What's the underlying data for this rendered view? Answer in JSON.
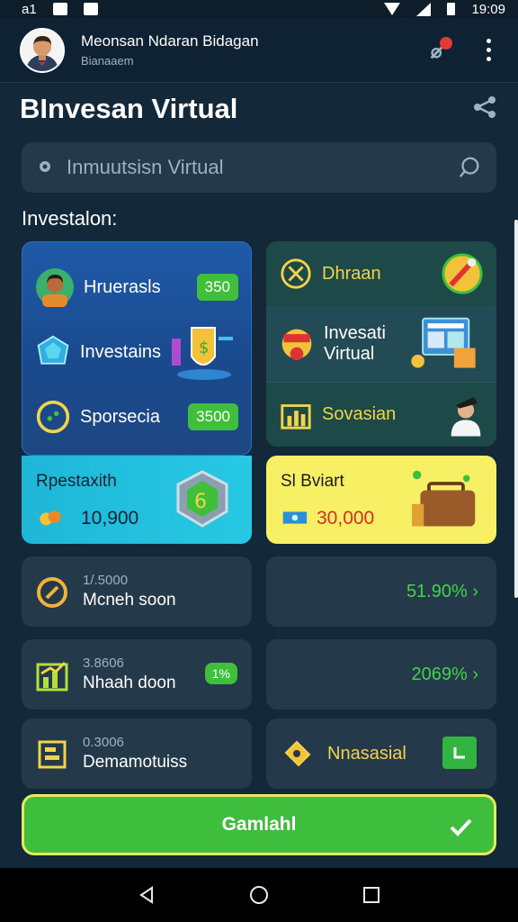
{
  "status_bar": {
    "left_text": "a1",
    "time": "19:09"
  },
  "header": {
    "name": "Meonsan Ndaran Bidagan",
    "subtitle": "Bianaaem"
  },
  "page_title": "Invesan Virtual",
  "title_prefix": "B",
  "search": {
    "placeholder": "Inmuutsisn Virtual"
  },
  "section_label": "Investalon:",
  "blue_card": {
    "rows": [
      {
        "label": "Hruerasls",
        "value": "350"
      },
      {
        "label": "Investains",
        "value": ""
      },
      {
        "label": "Sporsecia",
        "value": "3500"
      }
    ]
  },
  "dark_card": {
    "rows": [
      {
        "label": "Dhraan"
      },
      {
        "label": "Invesati Virtual"
      },
      {
        "label": "Sovasian"
      }
    ]
  },
  "cyan_card": {
    "title": "Rpestaxith",
    "value": "10,900"
  },
  "yellow_card": {
    "title": "Sl Bviart",
    "value": "30,000"
  },
  "stats": [
    {
      "small": "1/.5000",
      "big": "Mcneh soon",
      "right": "51.90%",
      "right_type": "pct"
    },
    {
      "small": "3.8606",
      "big": "Nhaah doon",
      "badge": "1%",
      "right": "2069%",
      "right_type": "pct"
    },
    {
      "small": "0.3006",
      "big": "Demamotuiss",
      "right_label": "Nnasasial",
      "right_type": "square"
    }
  ],
  "main_button": {
    "label": "Gamlahl"
  },
  "colors": {
    "accent_green": "#3fbd3d",
    "accent_yellow": "#f7f064",
    "accent_cyan": "#1fb6d8",
    "accent_blue": "#1f5aa8"
  }
}
